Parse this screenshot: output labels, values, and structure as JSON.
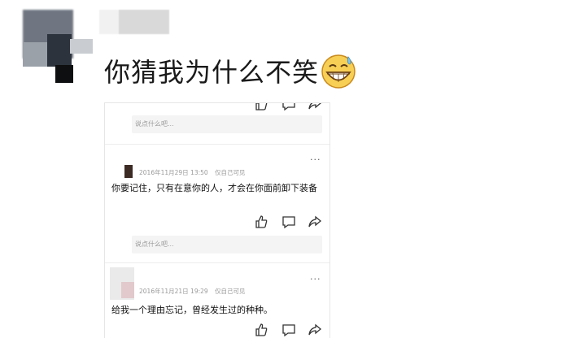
{
  "post": {
    "text": "你猜我为什么不笑",
    "emoji": "grinning-sweat-emoji"
  },
  "screenshot": {
    "input_placeholder_1": "说点什么吧...",
    "comment_1": {
      "date": "2016年11月29日 13:50",
      "visibility": "仅自己可见",
      "text": "你要记住，只有在意你的人，才会在你面前卸下装备"
    },
    "input_placeholder_2": "说点什么吧...",
    "comment_2": {
      "date": "2016年11月21日 19:29",
      "visibility": "仅自己可见",
      "text": "给我一个理由忘记，曾经发生过的种种。"
    },
    "more_label": "···"
  },
  "colors": {
    "text_dark": "#1a1a1a",
    "meta_gray": "#999999",
    "input_bg": "#f4f4f4"
  }
}
